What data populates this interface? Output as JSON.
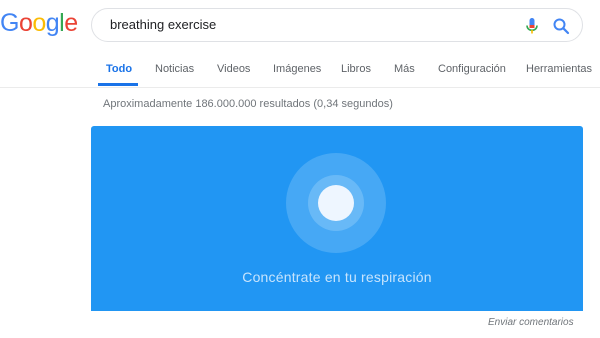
{
  "logo": {
    "text": "Google",
    "letters": [
      "G",
      "o",
      "o",
      "g",
      "l",
      "e"
    ],
    "colors": [
      "#4285f4",
      "#ea4335",
      "#fbbc05",
      "#4285f4",
      "#34a853",
      "#ea4335"
    ]
  },
  "search": {
    "query": "breathing exercise",
    "mic_icon": "microphone-icon",
    "search_icon": "magnifier-icon"
  },
  "tabs": [
    {
      "label": "Todo",
      "active": true
    },
    {
      "label": "Noticias",
      "active": false
    },
    {
      "label": "Videos",
      "active": false
    },
    {
      "label": "Imágenes",
      "active": false
    },
    {
      "label": "Libros",
      "active": false
    },
    {
      "label": "Más",
      "active": false
    },
    {
      "label": "Configuración",
      "active": false
    },
    {
      "label": "Herramientas",
      "active": false
    }
  ],
  "results_stats": "Aproximadamente 186.000.000 resultados (0,34 segundos)",
  "breathing_widget": {
    "caption": "Concéntrate en tu respiración",
    "background": "#2196f3"
  },
  "feedback_label": "Enviar comentarios",
  "colors": {
    "accent": "#1a73e8"
  }
}
